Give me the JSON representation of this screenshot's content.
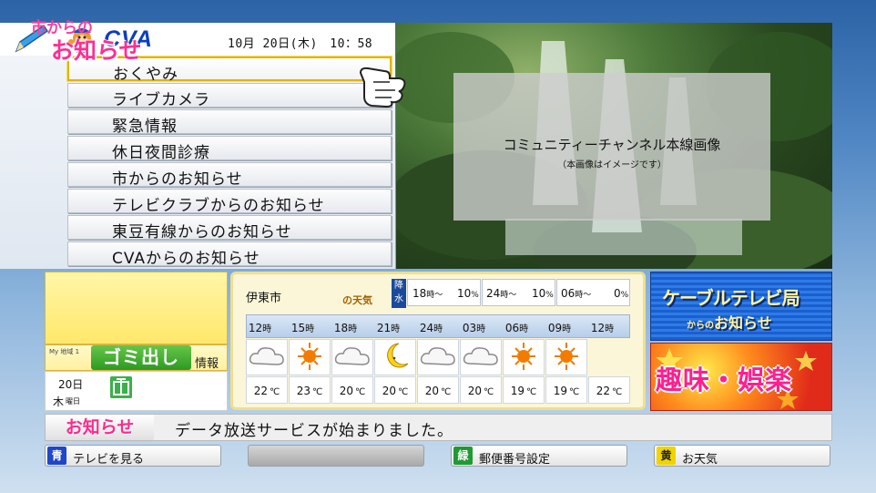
{
  "header": {
    "logo_text": "CVA",
    "datetime": "10月 20日(木)　10：58"
  },
  "menu": {
    "items": [
      {
        "label": "おくやみ",
        "active": true
      },
      {
        "label": "ライブカメラ"
      },
      {
        "label": "緊急情報"
      },
      {
        "label": "休日夜間診療"
      },
      {
        "label": "市からのお知らせ"
      },
      {
        "label": "テレビクラブからのお知らせ"
      },
      {
        "label": "東豆有線からのお知らせ"
      },
      {
        "label": "CVAからのお知らせ"
      }
    ]
  },
  "video": {
    "caption": "コミュニティーチャンネル本線画像",
    "subcaption": "（本画像はイメージです）"
  },
  "city_notice": {
    "line1": "市からの",
    "line2": "お知らせ"
  },
  "garbage": {
    "my_region": "My 地域 1",
    "title": "ゴミ出し",
    "info": "情報"
  },
  "calendar": {
    "day": "20日",
    "weekday": "木",
    "weekday_suffix": "曜日"
  },
  "weather": {
    "city": "伊東市",
    "suffix": "の天気",
    "precip_label": "降水",
    "precip": [
      {
        "time": "18",
        "unit": "時～",
        "value": "10",
        "pct": "%"
      },
      {
        "time": "24",
        "unit": "時～",
        "value": "10",
        "pct": "%"
      },
      {
        "time": "06",
        "unit": "時～",
        "value": "0",
        "pct": "%"
      }
    ],
    "hour_unit": "時",
    "hours": [
      "12",
      "15",
      "18",
      "21",
      "24",
      "03",
      "06",
      "09",
      "12"
    ],
    "icons": [
      "cloud-icon",
      "sun-icon",
      "cloud-icon",
      "moon-icon",
      "cloud-icon",
      "cloud-icon",
      "sun-icon",
      "sun-icon"
    ],
    "temp_unit": "℃",
    "temps": [
      "22",
      "23",
      "20",
      "20",
      "20",
      "20",
      "19",
      "19",
      "22"
    ]
  },
  "banners": {
    "cable_l1": "ケーブルテレビ局",
    "cable_l2a": "からの",
    "cable_l2b": "お知らせ",
    "hobby": "趣味・娯楽"
  },
  "ticker": {
    "label": "お知らせ",
    "text": "データ放送サービスが始まりました。"
  },
  "footer": {
    "buttons": [
      {
        "key": "青",
        "label": "テレビを見る",
        "color": "#1f47c8"
      },
      {
        "key": "",
        "label": "",
        "color": ""
      },
      {
        "key": "緑",
        "label": "郵便番号設定",
        "color": "#1f9a33"
      },
      {
        "key": "黄",
        "label": "お天気",
        "color": "#f0d400"
      }
    ]
  },
  "colors": {
    "accent_pink": "#ff2a8a",
    "menu_highlight": "#e2b400",
    "brand_blue": "#0a3fbf"
  }
}
